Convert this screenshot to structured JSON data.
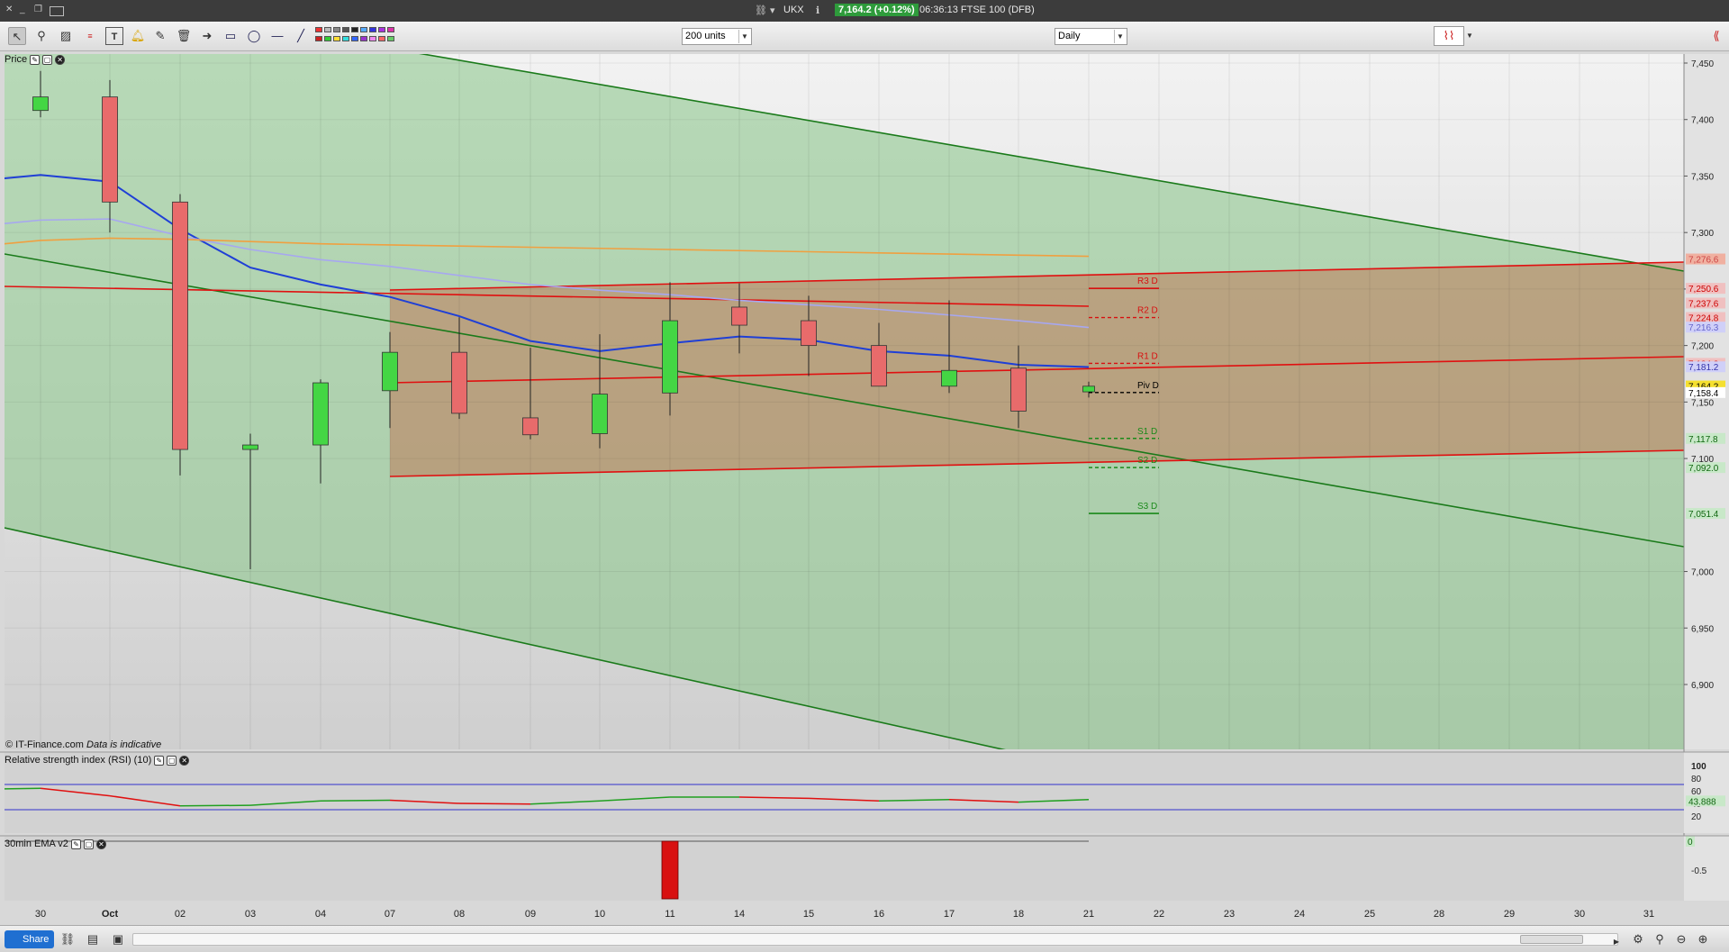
{
  "window": {
    "symbol": "UKX",
    "price_pill": "7,164.2 (+0.12%)",
    "status": "06:36:13 FTSE 100 (DFB)"
  },
  "toolbar": {
    "units_select": "200 units",
    "period_select": "Daily",
    "tools": [
      "pointer-icon",
      "zoom-icon",
      "chart-type-icon",
      "text-icon",
      "fib-icon",
      "alert-icon",
      "measure-icon",
      "trash-icon",
      "arrow-icon",
      "rectangle-icon",
      "ellipse-icon",
      "hline-icon",
      "trendline-icon"
    ]
  },
  "panels": {
    "price_title": "Price",
    "rsi_title": "Relative strength index (RSI) (10)",
    "ema_title": "30min EMA v2",
    "copyright": "© IT-Finance.com",
    "indicative": "Data is indicative"
  },
  "statusbar": {
    "share_label": "Share"
  },
  "colors": {
    "bull": "#44d644",
    "bear": "#e86b6b",
    "ema_blue": "#1f3fd6",
    "ma_lavender": "#a7a7f0",
    "ma_orange": "#f0a040",
    "channel_red": "#e01010",
    "channel_green": "#1a7a1a",
    "pivot_r": "#d81010",
    "pivot_s": "#1a8a1a"
  },
  "chart_data": [
    {
      "type": "candlestick",
      "title": "Price",
      "x_labels": [
        "30",
        "Oct",
        "02",
        "03",
        "04",
        "07",
        "08",
        "09",
        "10",
        "11",
        "14",
        "15",
        "16",
        "17",
        "18",
        "21",
        "22",
        "23",
        "24",
        "25",
        "28",
        "29",
        "30",
        "31"
      ],
      "y_ticks": [
        "7,450",
        "7,400",
        "7,350",
        "7,300",
        "7,250",
        "7,200",
        "7,150",
        "7,100",
        "7,000",
        "6,950",
        "6,900"
      ],
      "ylim": [
        6840,
        7460
      ],
      "candles": [
        {
          "x": "30",
          "open": 7408,
          "high": 7443,
          "low": 7402,
          "close": 7420
        },
        {
          "x": "Oct",
          "open": 7420,
          "high": 7435,
          "low": 7300,
          "close": 7327
        },
        {
          "x": "02",
          "open": 7327,
          "high": 7334,
          "low": 7085,
          "close": 7108
        },
        {
          "x": "03",
          "open": 7108,
          "high": 7122,
          "low": 7002,
          "close": 7112
        },
        {
          "x": "04",
          "open": 7112,
          "high": 7170,
          "low": 7078,
          "close": 7167
        },
        {
          "x": "07",
          "open": 7160,
          "high": 7212,
          "low": 7127,
          "close": 7194
        },
        {
          "x": "08",
          "open": 7194,
          "high": 7225,
          "low": 7135,
          "close": 7140
        },
        {
          "x": "09",
          "open": 7136,
          "high": 7198,
          "low": 7117,
          "close": 7121
        },
        {
          "x": "10",
          "open": 7122,
          "high": 7210,
          "low": 7109,
          "close": 7157
        },
        {
          "x": "11",
          "open": 7158,
          "high": 7256,
          "low": 7138,
          "close": 7222
        },
        {
          "x": "14",
          "open": 7234,
          "high": 7255,
          "low": 7193,
          "close": 7218
        },
        {
          "x": "15",
          "open": 7222,
          "high": 7244,
          "low": 7173,
          "close": 7200
        },
        {
          "x": "16",
          "open": 7200,
          "high": 7220,
          "low": 7168,
          "close": 7164
        },
        {
          "x": "17",
          "open": 7164,
          "high": 7240,
          "low": 7158,
          "close": 7178
        },
        {
          "x": "18",
          "open": 7180,
          "high": 7200,
          "low": 7127,
          "close": 7142
        },
        {
          "x": "21",
          "open": 7159,
          "high": 7168,
          "low": 7154,
          "close": 7164
        }
      ],
      "moving_averages": [
        {
          "color": "blue",
          "x": [
            "30",
            "Oct",
            "02",
            "03",
            "04",
            "07",
            "08",
            "09",
            "10",
            "11",
            "14",
            "15",
            "16",
            "17",
            "18",
            "21"
          ],
          "values": [
            7351,
            7345,
            7303,
            7269,
            7254,
            7243,
            7226,
            7204,
            7195,
            7202,
            7208,
            7205,
            7195,
            7191,
            7183,
            7181
          ]
        },
        {
          "color": "lavender",
          "x": [
            "30",
            "Oct",
            "02",
            "03",
            "04",
            "07",
            "08",
            "09",
            "10",
            "11",
            "14",
            "15",
            "16",
            "17",
            "18",
            "21"
          ],
          "values": [
            7311,
            7312,
            7297,
            7285,
            7276,
            7270,
            7262,
            7254,
            7249,
            7245,
            7240,
            7236,
            7232,
            7227,
            7222,
            7216
          ]
        },
        {
          "color": "orange",
          "x": [
            "30",
            "Oct",
            "02",
            "03",
            "04",
            "07",
            "08",
            "09",
            "10",
            "11",
            "14",
            "15",
            "16",
            "17",
            "18",
            "21"
          ],
          "values": [
            7293,
            7295,
            7294,
            7292,
            7290,
            7289,
            7288,
            7287,
            7286,
            7285,
            7284,
            7283,
            7282,
            7281,
            7280,
            7279
          ]
        }
      ],
      "pivots": [
        {
          "label": "R3 D",
          "value": 7250.6
        },
        {
          "label": "R2 D",
          "value": 7224.8
        },
        {
          "label": "R1 D",
          "value": 7184.2
        },
        {
          "label": "Piv D",
          "value": 7158.4
        },
        {
          "label": "S1 D",
          "value": 7117.8
        },
        {
          "label": "S2 D",
          "value": 7092.0
        },
        {
          "label": "S3 D",
          "value": 7051.4
        }
      ],
      "price_tags": [
        "7,276.6",
        "7,250.6",
        "7,237.6",
        "7,224.8",
        "7,216.3",
        "7,184.2",
        "7,181.2",
        "7,164.2",
        "7,158.4",
        "7,117.8",
        "7,092.0",
        "7,051.4"
      ]
    },
    {
      "type": "line",
      "title": "Relative strength index (RSI) (10)",
      "y_ticks": [
        "100",
        "80",
        "60",
        "40",
        "20"
      ],
      "ylim": [
        0,
        100
      ],
      "levels": [
        70,
        30
      ],
      "last_value_tag": "43.888",
      "x": [
        "30",
        "Oct",
        "02",
        "03",
        "04",
        "07",
        "08",
        "09",
        "10",
        "11",
        "14",
        "15",
        "16",
        "17",
        "18",
        "21"
      ],
      "values": [
        63,
        64,
        52,
        36,
        37,
        44,
        45,
        40,
        39,
        44,
        50,
        50,
        48,
        44,
        46,
        42,
        46
      ]
    },
    {
      "type": "bar",
      "title": "30min EMA v2",
      "y_ticks": [
        "0",
        "-0.5"
      ],
      "last_value_tag": "0",
      "bars": [
        {
          "x": "11",
          "value": -1
        }
      ]
    }
  ]
}
